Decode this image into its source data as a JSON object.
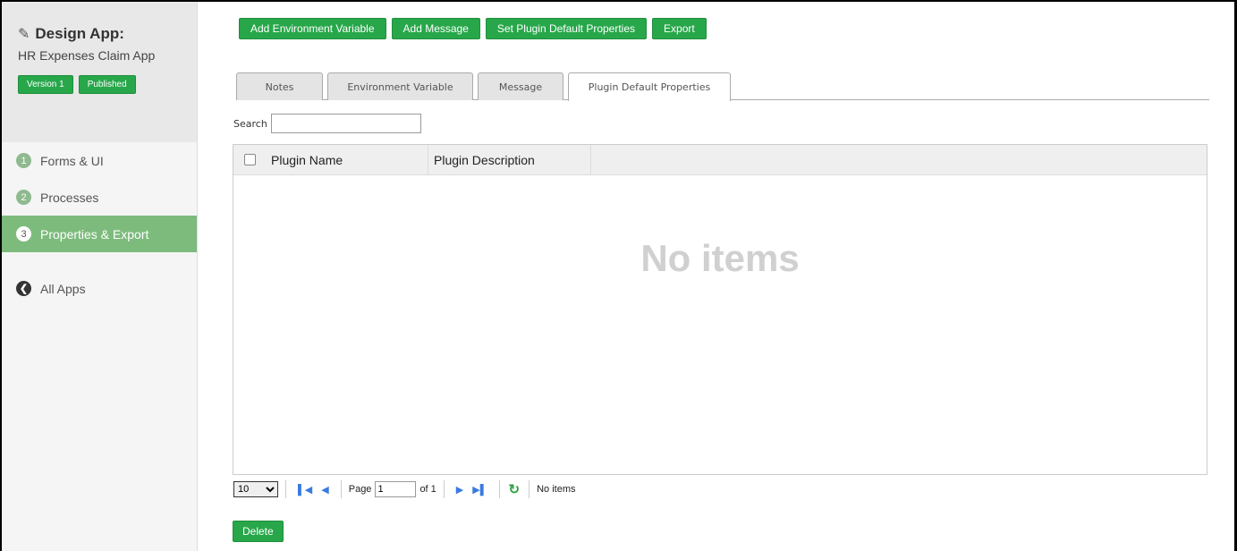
{
  "sidebar": {
    "app_title": "Design App:",
    "app_name": "HR Expenses Claim App",
    "version_badge": "Version 1",
    "status_badge": "Published",
    "items": [
      {
        "num": "1",
        "label": "Forms & UI"
      },
      {
        "num": "2",
        "label": "Processes"
      },
      {
        "num": "3",
        "label": "Properties & Export"
      }
    ],
    "all_apps_label": "All Apps"
  },
  "toolbar": {
    "add_env_var": "Add Environment Variable",
    "add_message": "Add Message",
    "set_plugin_defaults": "Set Plugin Default Properties",
    "export": "Export"
  },
  "tabs": [
    {
      "label": "Notes"
    },
    {
      "label": "Environment Variable"
    },
    {
      "label": "Message"
    },
    {
      "label": "Plugin Default Properties"
    }
  ],
  "search": {
    "label": "Search",
    "value": ""
  },
  "grid": {
    "columns": [
      "Plugin Name",
      "Plugin Description"
    ],
    "empty_message": "No items"
  },
  "pager": {
    "page_size": "10",
    "page_label": "Page",
    "page_value": "1",
    "of_label": "of 1",
    "status": "No items"
  },
  "footer": {
    "delete": "Delete"
  },
  "colors": {
    "accent_green": "#27a74a",
    "active_nav": "#7dbb7d"
  }
}
